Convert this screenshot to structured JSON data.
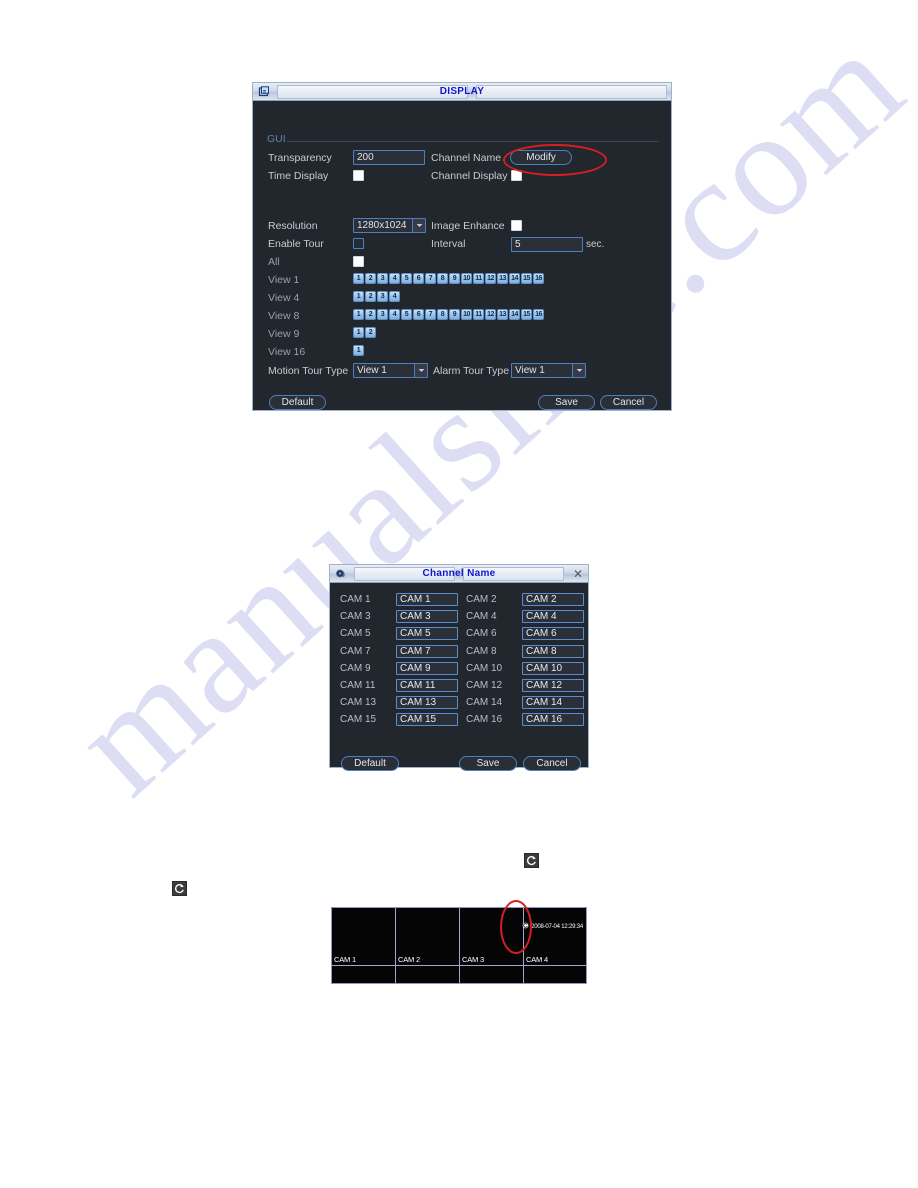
{
  "watermark": {
    "text": "manualslive.com"
  },
  "display_dialog": {
    "title": "DISPLAY",
    "title_icon": "window-icon",
    "group_label": "GUI",
    "fields": {
      "transparency_label": "Transparency",
      "transparency_value": "200",
      "channel_name_label": "Channel Name",
      "modify_button": "Modify",
      "time_display_label": "Time Display",
      "channel_display_label": "Channel Display",
      "resolution_label": "Resolution",
      "resolution_value": "1280x1024",
      "image_enhance_label": "Image Enhance",
      "enable_tour_label": "Enable Tour",
      "interval_label": "Interval",
      "interval_value": "5",
      "interval_suffix": "sec.",
      "all_label": "All",
      "motion_tour_type_label": "Motion Tour Type",
      "motion_tour_type_value": "View 1",
      "alarm_tour_type_label": "Alarm Tour Type",
      "alarm_tour_type_value": "View 1"
    },
    "view_rows": [
      {
        "label": "View 1",
        "channels": [
          "1",
          "2",
          "3",
          "4",
          "5",
          "6",
          "7",
          "8",
          "9",
          "10",
          "11",
          "12",
          "13",
          "14",
          "15",
          "16"
        ]
      },
      {
        "label": "View 4",
        "channels": [
          "1",
          "2",
          "3",
          "4"
        ]
      },
      {
        "label": "View 8",
        "channels": [
          "1",
          "2",
          "3",
          "4",
          "5",
          "6",
          "7",
          "8",
          "9",
          "10",
          "11",
          "12",
          "13",
          "14",
          "15",
          "16"
        ]
      },
      {
        "label": "View 9",
        "channels": [
          "1",
          "2"
        ]
      },
      {
        "label": "View 16",
        "channels": [
          "1"
        ]
      }
    ],
    "buttons": {
      "default_label": "Default",
      "save_label": "Save",
      "cancel_label": "Cancel"
    }
  },
  "channel_name_dialog": {
    "title": "Channel Name",
    "title_icon": "camera-icon",
    "close_icon": "close-icon",
    "rows": [
      {
        "left_label": "CAM 1",
        "left_value": "CAM 1",
        "right_label": "CAM 2",
        "right_value": "CAM 2"
      },
      {
        "left_label": "CAM 3",
        "left_value": "CAM 3",
        "right_label": "CAM 4",
        "right_value": "CAM 4"
      },
      {
        "left_label": "CAM 5",
        "left_value": "CAM 5",
        "right_label": "CAM 6",
        "right_value": "CAM 6"
      },
      {
        "left_label": "CAM 7",
        "left_value": "CAM 7",
        "right_label": "CAM 8",
        "right_value": "CAM 8"
      },
      {
        "left_label": "CAM 9",
        "left_value": "CAM 9",
        "right_label": "CAM 10",
        "right_value": "CAM 10"
      },
      {
        "left_label": "CAM 11",
        "left_value": "CAM 11",
        "right_label": "CAM 12",
        "right_value": "CAM 12"
      },
      {
        "left_label": "CAM 13",
        "left_value": "CAM 13",
        "right_label": "CAM 14",
        "right_value": "CAM 14"
      },
      {
        "left_label": "CAM 15",
        "left_value": "CAM 15",
        "right_label": "CAM 16",
        "right_value": "CAM 16"
      }
    ],
    "buttons": {
      "default_label": "Default",
      "save_label": "Save",
      "cancel_label": "Cancel"
    }
  },
  "live_preview": {
    "panes": [
      "CAM 1",
      "CAM 2",
      "CAM 3",
      "CAM 4"
    ],
    "osd_icon": "tour-icon",
    "osd_text": "2008-07-04 12:29:34"
  },
  "tour_icons": {
    "inline_icon": "tour-rotate-icon",
    "osd_icon": "tour-rotate-icon"
  },
  "colors": {
    "dialog_bg": "#22262d",
    "accent_border": "#4d7ebf",
    "title_text": "#1414d2",
    "annotation_red": "#d61f22",
    "badge_blue": "#9cc3e8"
  }
}
